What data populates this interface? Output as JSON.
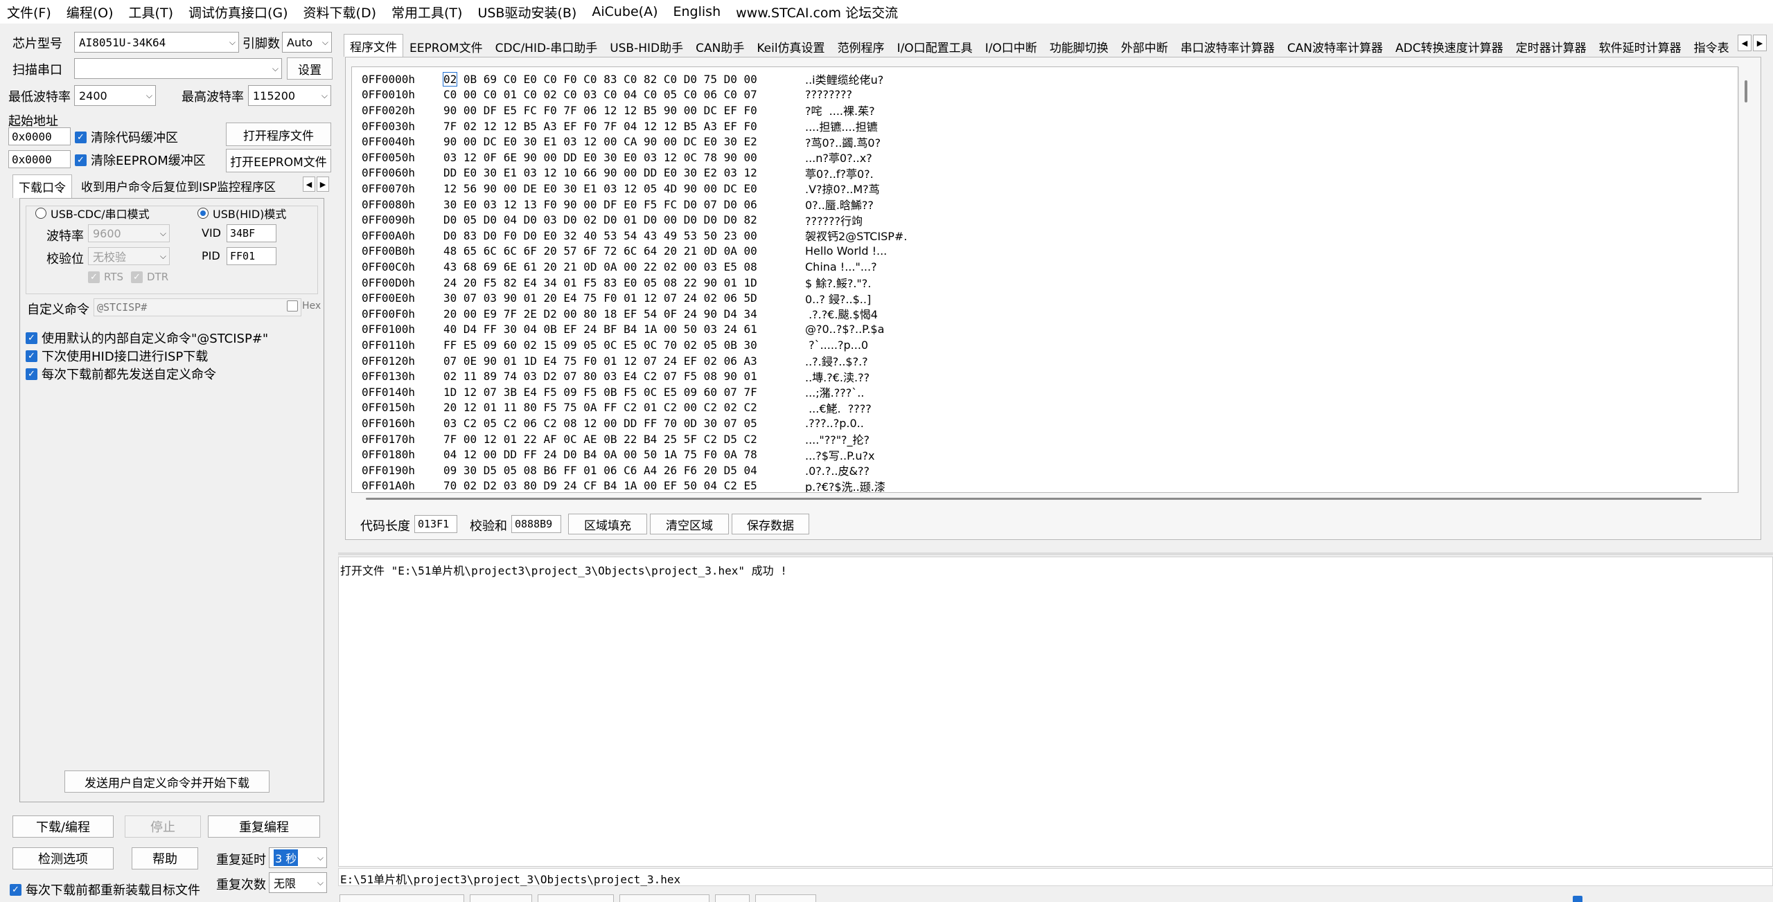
{
  "menu": [
    "文件(F)",
    "编程(O)",
    "工具(T)",
    "调试仿真接口(G)",
    "资料下载(D)",
    "常用工具(T)",
    "USB驱动安装(B)",
    "AiCube(A)",
    "English",
    "www.STCAI.com 论坛交流"
  ],
  "left": {
    "chip_label": "芯片型号",
    "chip_value": "AI8051U-34K64",
    "pins_label": "引脚数",
    "pins_value": "Auto",
    "scan_label": "扫描串口",
    "scan_value": "",
    "settings_btn": "设置",
    "min_baud_label": "最低波特率",
    "min_baud": "2400",
    "max_baud_label": "最高波特率",
    "max_baud": "115200",
    "start_addr_label": "起始地址",
    "addr1": "0x0000",
    "clear_code": "清除代码缓冲区",
    "open_program": "打开程序文件",
    "addr2": "0x0000",
    "clear_eeprom": "清除EEPROM缓冲区",
    "open_eeprom": "打开EEPROM文件",
    "tabs": [
      "下载口令",
      "收到用户命令后复位到ISP监控程序区"
    ],
    "usb_cdc": "USB-CDC/串口模式",
    "usb_hid": "USB(HID)模式",
    "baud_label": "波特率",
    "baud_value": "9600",
    "parity_label": "校验位",
    "parity_value": "无校验",
    "rts": "RTS",
    "dtr": "DTR",
    "vid_label": "VID",
    "vid": "34BF",
    "pid_label": "PID",
    "pid": "FF01",
    "custom_cmd_label": "自定义命令",
    "custom_cmd": "@STCISP#",
    "hex_label": "Hex",
    "opt1": "使用默认的内部自定义命令\"@STCISP#\"",
    "opt2": "下次使用HID接口进行ISP下载",
    "opt3": "每次下载前都先发送自定义命令",
    "send_btn": "发送用户自定义命令并开始下载",
    "download_btn": "下载/编程",
    "stop_btn": "停止",
    "reprogram_btn": "重复编程",
    "detect_btn": "检测选项",
    "help_btn": "帮助",
    "delay_label": "重复延时",
    "delay_value": "3 秒",
    "repeat_label": "重复次数",
    "repeat_value": "无限",
    "reload_label": "每次下载前都重新装载目标文件"
  },
  "right_tabs": [
    "程序文件",
    "EEPROM文件",
    "CDC/HID-串口助手",
    "USB-HID助手",
    "CAN助手",
    "Keil仿真设置",
    "范例程序",
    "I/O口配置工具",
    "I/O口中断",
    "功能脚切换",
    "外部中断",
    "串口波特率计算器",
    "CAN波特率计算器",
    "ADC转换速度计算器",
    "定时器计算器",
    "软件延时计算器",
    "指令表"
  ],
  "hex_rows": [
    {
      "addr": "0FF0000h",
      "bytes": "02 0B 69 C0 E0 C0 F0 C0 83 C0 82 C0 D0 75 D0 00",
      "ascii": "..i类鲤缆纶佬u?"
    },
    {
      "addr": "0FF0010h",
      "bytes": "C0 00 C0 01 C0 02 C0 03 C0 04 C0 05 C0 06 C0 07",
      "ascii": "????????"
    },
    {
      "addr": "0FF0020h",
      "bytes": "90 00 DF E5 FC F0 7F 06 12 12 B5 90 00 DC EF F0",
      "ascii": "?咤  ....裸.茱?"
    },
    {
      "addr": "0FF0030h",
      "bytes": "7F 02 12 12 B5 A3 EF F0 7F 04 12 12 B5 A3 EF F0",
      "ascii": "....担镳....担镳"
    },
    {
      "addr": "0FF0040h",
      "bytes": "90 00 DC E0 30 E1 03 12 00 CA 90 00 DC E0 30 E2",
      "ascii": "?茑0?..蠲.茑0?"
    },
    {
      "addr": "0FF0050h",
      "bytes": "03 12 0F 6E 90 00 DD E0 30 E0 03 12 0C 78 90 00",
      "ascii": "...n?葶0?..x?"
    },
    {
      "addr": "0FF0060h",
      "bytes": "DD E0 30 E1 03 12 10 66 90 00 DD E0 30 E2 03 12",
      "ascii": "葶0?..f?葶0?."
    },
    {
      "addr": "0FF0070h",
      "bytes": "12 56 90 00 DE E0 30 E1 03 12 05 4D 90 00 DC E0",
      "ascii": ".V?掠0?..M?茑"
    },
    {
      "addr": "0FF0080h",
      "bytes": "30 E0 03 12 13 F0 90 00 DF E0 F5 FC D0 07 D0 06",
      "ascii": "0?..蜃.晗鯑??"
    },
    {
      "addr": "0FF0090h",
      "bytes": "D0 05 D0 04 D0 03 D0 02 D0 01 D0 00 D0 D0 D0 82",
      "ascii": "??????行竘"
    },
    {
      "addr": "0FF00A0h",
      "bytes": "D0 83 D0 F0 D0 E0 32 40 53 54 43 49 53 50 23 00",
      "ascii": "袈衩钙2@STCISP#."
    },
    {
      "addr": "0FF00B0h",
      "bytes": "48 65 6C 6C 6F 20 57 6F 72 6C 64 20 21 0D 0A 00",
      "ascii": "Hello World !..."
    },
    {
      "addr": "0FF00C0h",
      "bytes": "43 68 69 6E 61 20 21 0D 0A 00 22 02 00 03 E5 08",
      "ascii": "China !...\"...?"
    },
    {
      "addr": "0FF00D0h",
      "bytes": "24 20 F5 82 E4 34 01 F5 83 E0 05 08 22 90 01 1D",
      "ascii": "$ 鮽?.鮾?.\"?."
    },
    {
      "addr": "0FF00E0h",
      "bytes": "30 07 03 90 01 20 E4 75 F0 01 12 07 24 02 06 5D",
      "ascii": "0..? 鋟?..$..]"
    },
    {
      "addr": "0FF00F0h",
      "bytes": "20 00 E9 7F 2E D2 00 80 18 EF 54 0F 24 90 D4 34",
      "ascii": " .?.?€.颰.$愒4"
    },
    {
      "addr": "0FF0100h",
      "bytes": "40 D4 FF 30 04 0B EF 24 BF B4 1A 00 50 03 24 61",
      "ascii": "@?0..?$?..P.$a"
    },
    {
      "addr": "0FF0110h",
      "bytes": "FF E5 09 60 02 15 09 05 0C E5 0C 70 02 05 0B 30",
      "ascii": " ?`.....?p...0"
    },
    {
      "addr": "0FF0120h",
      "bytes": "07 0E 90 01 1D E4 75 F0 01 12 07 24 EF 02 06 A3",
      "ascii": "..?.鋟?..$?.?"
    },
    {
      "addr": "0FF0130h",
      "bytes": "02 11 89 74 03 D2 07 80 03 E4 C2 07 F5 08 90 01",
      "ascii": "..塼.?€.渎.??"
    },
    {
      "addr": "0FF0140h",
      "bytes": "1D 12 07 3B E4 F5 09 F5 0B F5 0C E5 09 60 07 7F",
      "ascii": "...;潴.???`.."
    },
    {
      "addr": "0FF0150h",
      "bytes": "20 12 01 11 80 F5 75 0A FF C2 01 C2 00 C2 02 C2",
      "ascii": " ...€鮱.  ????"
    },
    {
      "addr": "0FF0160h",
      "bytes": "03 C2 05 C2 06 C2 08 12 00 DD FF 70 0D 30 07 05",
      "ascii": ".???..?p.0.."
    },
    {
      "addr": "0FF0170h",
      "bytes": "7F 00 12 01 22 AF 0C AE 0B 22 B4 25 5F C2 D5 C2",
      "ascii": "....\"??\"?_抡?"
    },
    {
      "addr": "0FF0180h",
      "bytes": "04 12 00 DD FF 24 D0 B4 0A 00 50 1A 75 F0 0A 78",
      "ascii": "...?$写..P.u?x"
    },
    {
      "addr": "0FF0190h",
      "bytes": "09 30 D5 05 08 B6 FF 01 06 C6 A4 26 F6 20 D5 04",
      "ascii": ".0?.?..皮&??"
    },
    {
      "addr": "0FF01A0h",
      "bytes": "70 02 D2 03 80 D9 24 CF B4 1A 00 EF 50 04 C2 E5",
      "ascii": "p.?€?$洗..颋.漆"
    }
  ],
  "bottom": {
    "code_len_label": "代码长度",
    "code_len": "013F1",
    "checksum_label": "校验和",
    "checksum": "0888B9",
    "fill_btn": "区域填充",
    "clear_btn": "清空区域",
    "save_btn": "保存数据"
  },
  "log_text": "打开文件 \"E:\\51单片机\\project3\\project_3\\Objects\\project_3.hex\" 成功 !",
  "status_path": "E:\\51单片机\\project3\\project_3\\Objects\\project_3.hex",
  "colors": {
    "accent": "#1f6fd1",
    "background": "#f0f0f0"
  }
}
